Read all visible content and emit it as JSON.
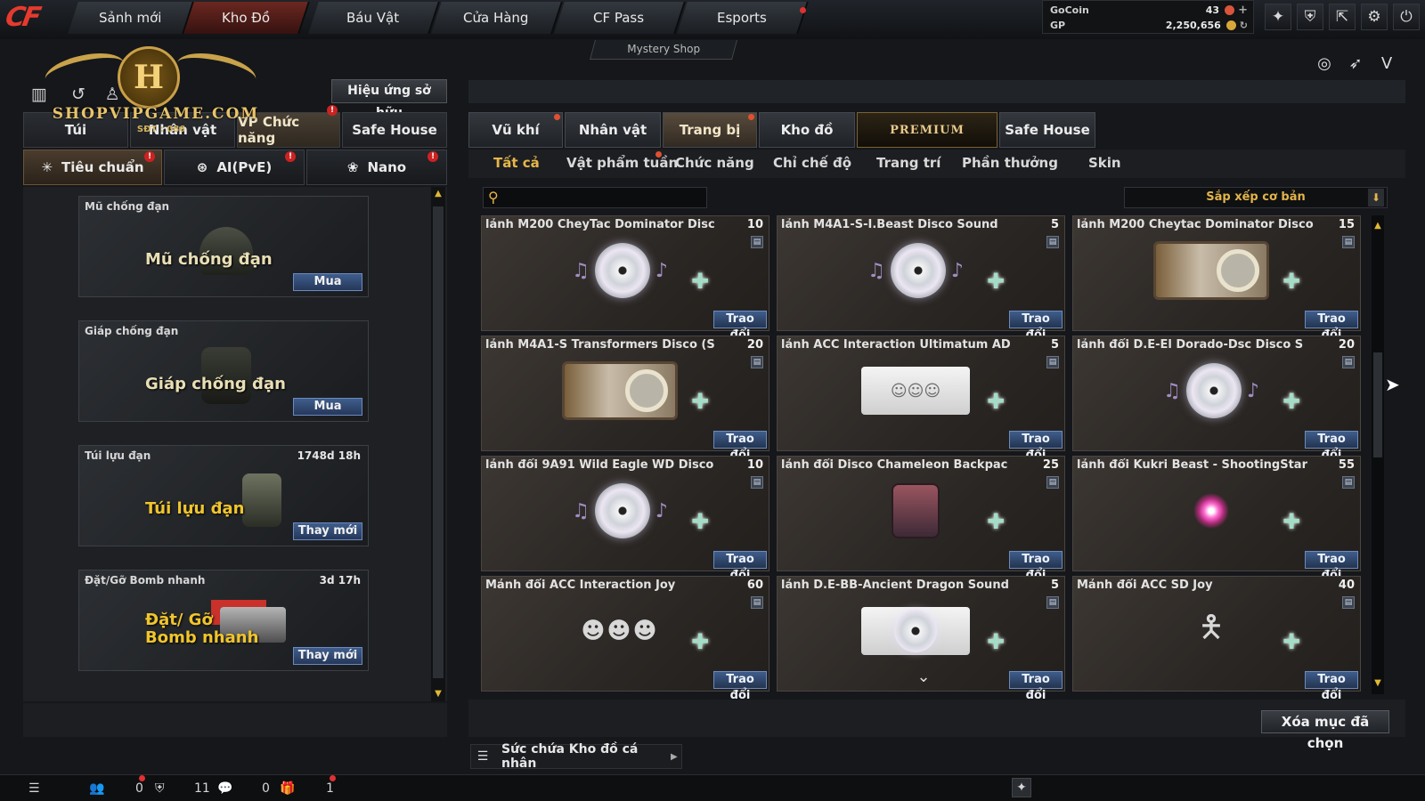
{
  "topnav": {
    "tabs": [
      "Sảnh mới",
      "Kho Đồ",
      "Báu Vật",
      "Cửa Hàng",
      "CF Pass",
      "Esports"
    ],
    "active": "Kho Đồ",
    "mystery_shop": "Mystery Shop"
  },
  "currency": {
    "gocoin_label": "GoCoin",
    "gocoin_value": "43",
    "gp_label": "GP",
    "gp_value": "2,250,656"
  },
  "watermark": {
    "letter": "H",
    "site": "SHOPVIPGAME.COM",
    "phone": "SĐT : 086"
  },
  "left": {
    "owned_effects": "Hiệu ứng sở hữu",
    "tabs": [
      "Túi",
      "Nhân vật",
      "VP Chức năng",
      "Safe House"
    ],
    "subtabs": [
      "Tiêu chuẩn",
      "AI(PvE)",
      "Nano"
    ],
    "items": [
      {
        "name": "Mũ chống đạn",
        "big": "Mũ chống đạn",
        "duration": "",
        "action": "Mua"
      },
      {
        "name": "Giáp chống đạn",
        "big": "Giáp chống đạn",
        "duration": "",
        "action": "Mua"
      },
      {
        "name": "Túi lựu đạn",
        "big": "Túi lựu đạn",
        "duration": "1748d 18h",
        "action": "Thay mới"
      },
      {
        "name": "Đặt/Gỡ Bomb nhanh",
        "big": "Đặt/ Gỡ Bomb nhanh",
        "duration": "3d 17h",
        "action": "Thay mới"
      }
    ]
  },
  "right": {
    "tabs": [
      "Vũ khí",
      "Nhân vật",
      "Trang bị",
      "Kho đồ",
      "PREMIUM",
      "Safe House"
    ],
    "subtabs": [
      "Tất cả",
      "Vật phẩm tuần",
      "Chức năng",
      "Chỉ chế độ",
      "Trang trí",
      "Phần thưởng",
      "Skin"
    ],
    "search_placeholder": "",
    "sort_label": "Sắp xếp cơ bản",
    "trade_label": "Trao đổi",
    "items": [
      {
        "name": "lảnh M200 CheyTac Dominator Disc",
        "qty": "10",
        "art": "disc"
      },
      {
        "name": "lảnh M4A1-S-I.Beast Disco Sound",
        "qty": "5",
        "art": "disc"
      },
      {
        "name": "lảnh M200 Cheytac Dominator Disco",
        "qty": "15",
        "art": "box"
      },
      {
        "name": "lảnh M4A1-S Transformers Disco (S",
        "qty": "20",
        "art": "box"
      },
      {
        "name": "lảnh ACC Interaction Ultimatum AD",
        "qty": "5",
        "art": "ticket"
      },
      {
        "name": "lảnh đổi D.E-El Dorado-Dsc Disco S",
        "qty": "20",
        "art": "disc"
      },
      {
        "name": "lảnh đổi 9A91 Wild Eagle WD Disco",
        "qty": "10",
        "art": "disc"
      },
      {
        "name": "lảnh đổi Disco Chameleon Backpac",
        "qty": "25",
        "art": "bag"
      },
      {
        "name": "lảnh đổi Kukri Beast - ShootingStar",
        "qty": "55",
        "art": "star"
      },
      {
        "name": "Mảnh đổi ACC Interaction Joy",
        "qty": "60",
        "art": "heads"
      },
      {
        "name": "lảnh D.E-BB-Ancient Dragon Sound",
        "qty": "5",
        "art": "ticketdisc"
      },
      {
        "name": "Mảnh đổi ACC SD Joy",
        "qty": "40",
        "art": "figure"
      }
    ],
    "delete_selected": "Xóa mục đã chọn",
    "capacity": "Sức chứa Kho đồ cá nhân"
  },
  "bottombar": {
    "count1": "0",
    "count2": "11",
    "count3": "0",
    "count4": "1"
  }
}
